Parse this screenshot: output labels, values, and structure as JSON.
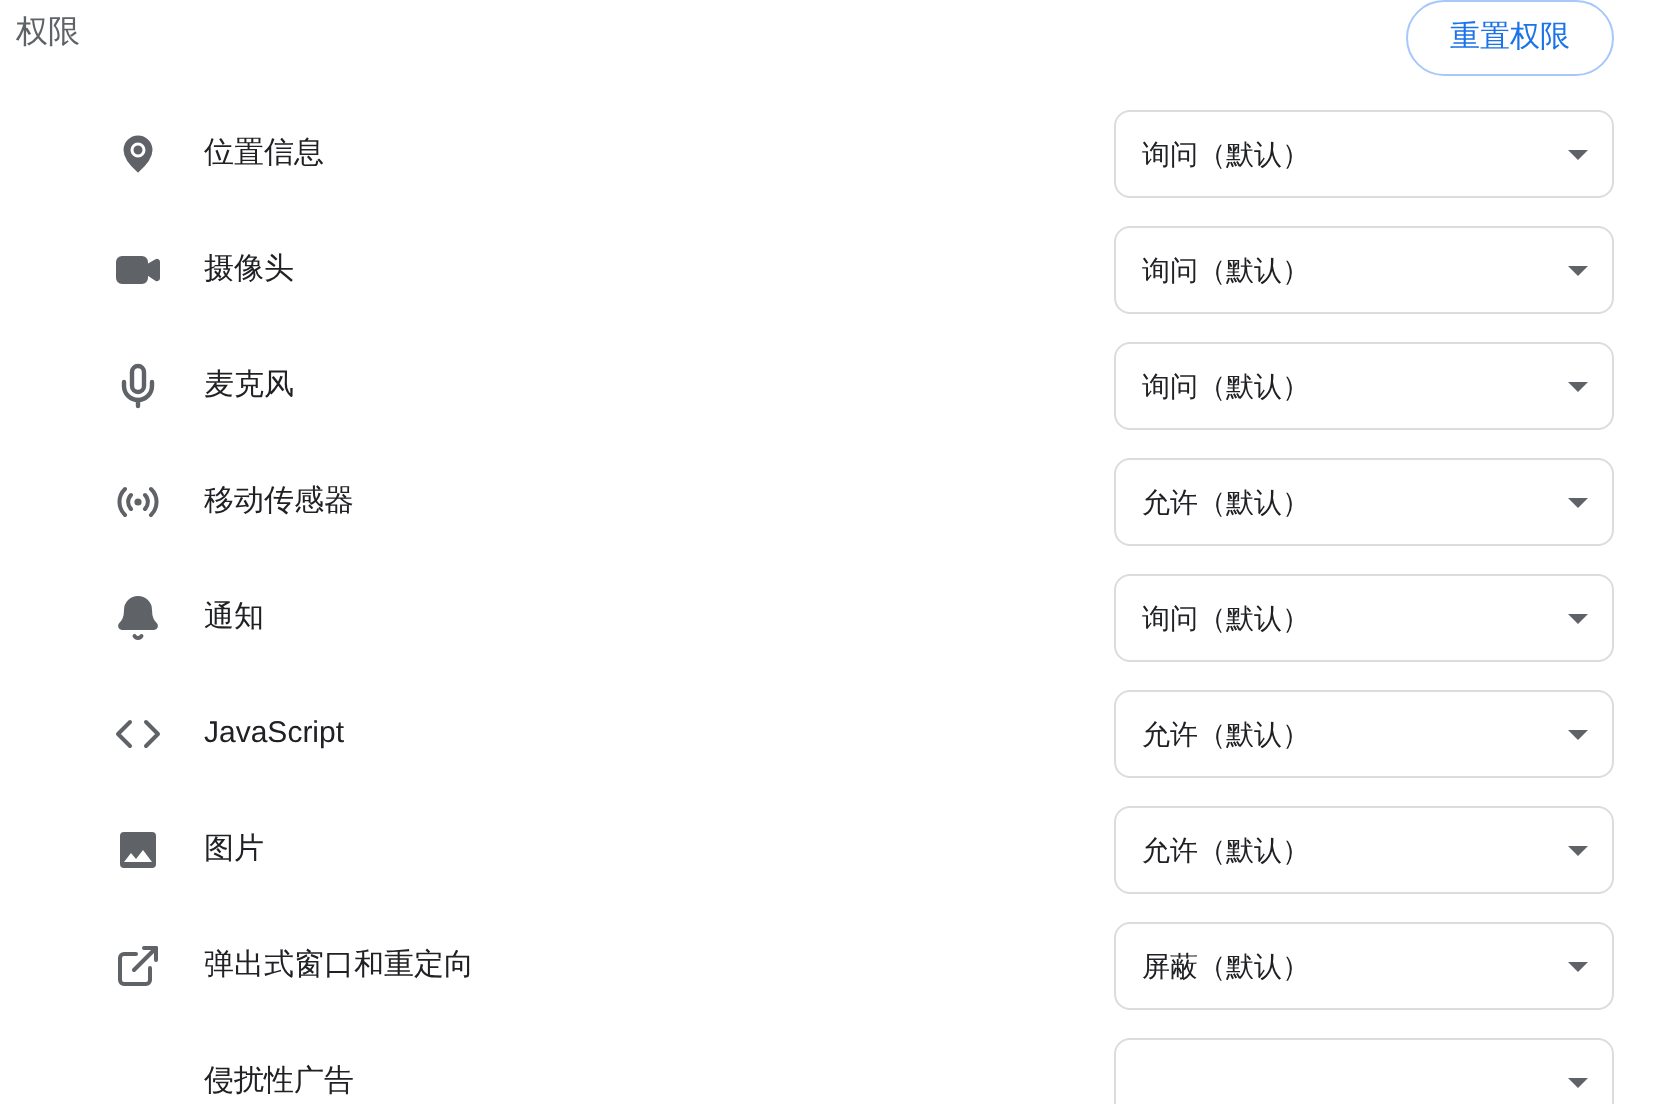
{
  "section_title": "权限",
  "reset_button": "重置权限",
  "permissions": [
    {
      "kind": "location",
      "label": "位置信息",
      "value": "询问（默认）"
    },
    {
      "kind": "camera",
      "label": "摄像头",
      "value": "询问（默认）"
    },
    {
      "kind": "microphone",
      "label": "麦克风",
      "value": "询问（默认）"
    },
    {
      "kind": "sensors",
      "label": "移动传感器",
      "value": "允许（默认）"
    },
    {
      "kind": "notifications",
      "label": "通知",
      "value": "询问（默认）"
    },
    {
      "kind": "code",
      "label": "JavaScript",
      "value": "允许（默认）"
    },
    {
      "kind": "image",
      "label": "图片",
      "value": "允许（默认）"
    },
    {
      "kind": "popup",
      "label": "弹出式窗口和重定向",
      "value": "屏蔽（默认）"
    },
    {
      "kind": "ads",
      "label": "侵扰性广告"
    }
  ]
}
